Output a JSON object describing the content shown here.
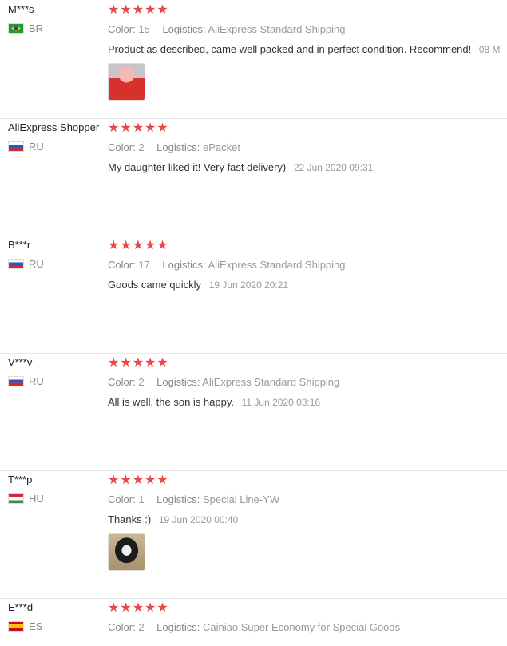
{
  "labels": {
    "color": "Color:",
    "logistics": "Logistics:"
  },
  "colors": {
    "star": "#e74848",
    "muted": "#999999"
  },
  "reviews": [
    {
      "name": "M***s",
      "country": "BR",
      "rating": "★★★★★",
      "color": "15",
      "logistics": "AliExpress Standard Shipping",
      "text": "Product as described, came well packed and in perfect condition. Recommend!",
      "date": "08 M",
      "has_photo": true
    },
    {
      "name": "AliExpress Shopper",
      "country": "RU",
      "rating": "★★★★★",
      "color": "2",
      "logistics": "ePacket",
      "text": "My daughter liked it! Very fast delivery)",
      "date": "22 Jun 2020 09:31",
      "has_photo": false
    },
    {
      "name": "B***r",
      "country": "RU",
      "rating": "★★★★★",
      "color": "17",
      "logistics": "AliExpress Standard Shipping",
      "text": "Goods came quickly",
      "date": "19 Jun 2020 20:21",
      "has_photo": false
    },
    {
      "name": "V***v",
      "country": "RU",
      "rating": "★★★★★",
      "color": "2",
      "logistics": "AliExpress Standard Shipping",
      "text": "All is well, the son is happy.",
      "date": "11 Jun 2020 03:16",
      "has_photo": false
    },
    {
      "name": "T***p",
      "country": "HU",
      "rating": "★★★★★",
      "color": "1",
      "logistics": "Special Line-YW",
      "text": "Thanks :)",
      "date": "19 Jun 2020 00:40",
      "has_photo": true
    },
    {
      "name": "E***d",
      "country": "ES",
      "rating": "★★★★★",
      "color": "2",
      "logistics": "Cainiao Super Economy for Special Goods",
      "text": "",
      "date": "",
      "has_photo": false
    }
  ]
}
